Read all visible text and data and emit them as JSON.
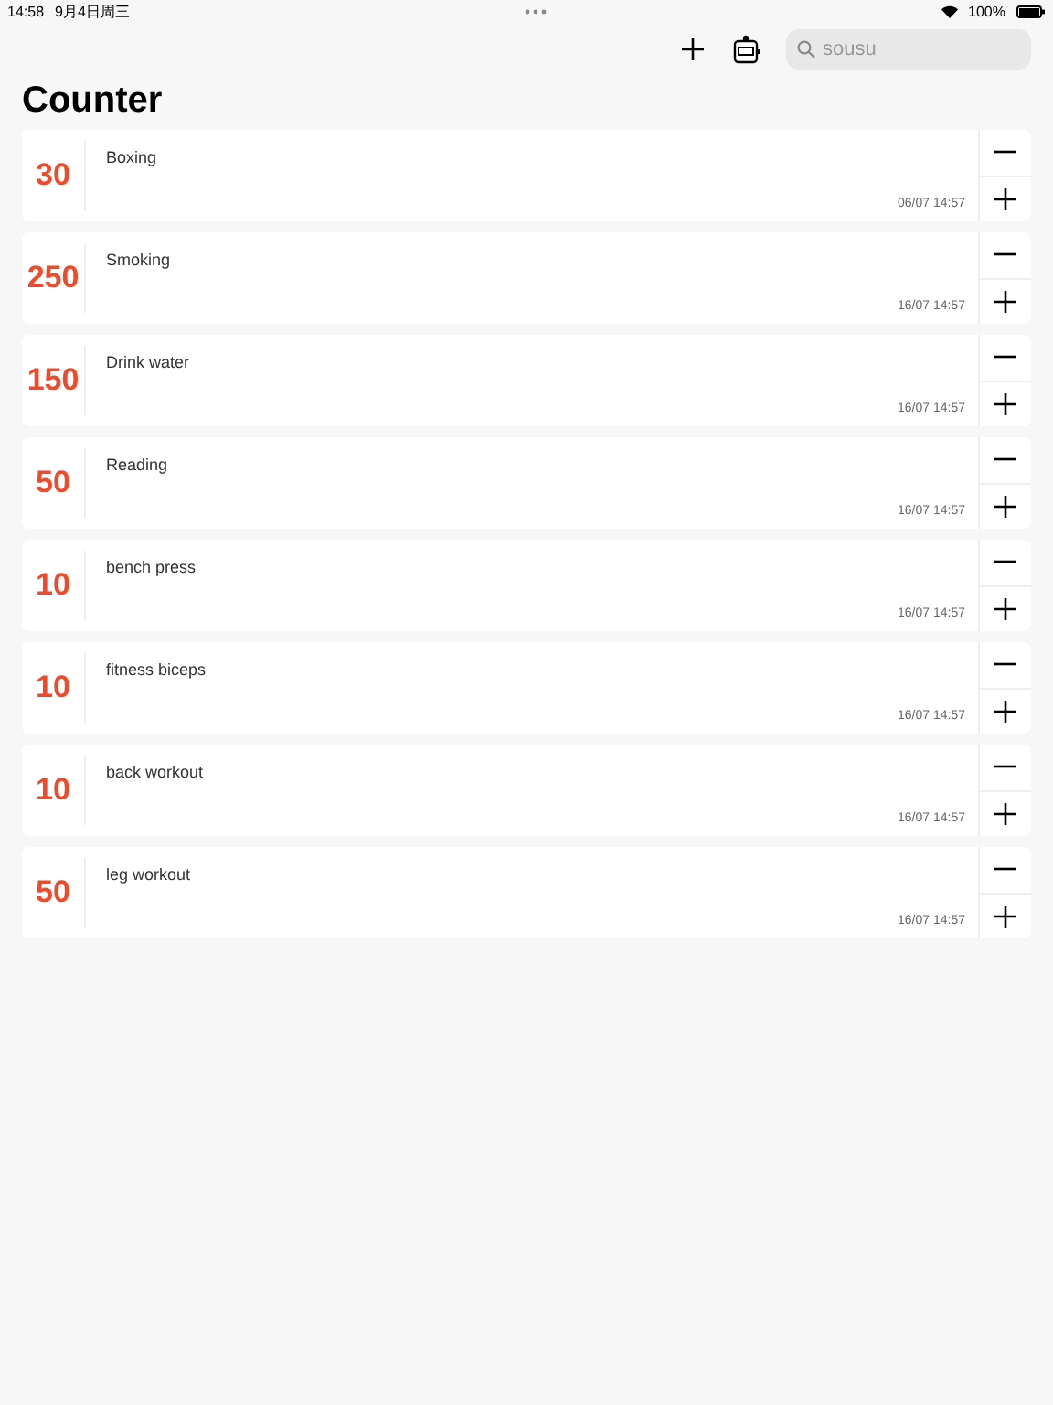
{
  "status_bar": {
    "time": "14:58",
    "date": "9月4日周三",
    "battery": "100%"
  },
  "toolbar": {
    "search": {
      "placeholder": "sousu"
    }
  },
  "title": "Counter",
  "counters": [
    {
      "count": "30",
      "name": "Boxing",
      "timestamp": "06/07 14:57"
    },
    {
      "count": "250",
      "name": "Smoking",
      "timestamp": "16/07 14:57"
    },
    {
      "count": "150",
      "name": "Drink water",
      "timestamp": "16/07 14:57"
    },
    {
      "count": "50",
      "name": "Reading",
      "timestamp": "16/07 14:57"
    },
    {
      "count": "10",
      "name": "bench press",
      "timestamp": "16/07 14:57"
    },
    {
      "count": "10",
      "name": "fitness biceps",
      "timestamp": "16/07 14:57"
    },
    {
      "count": "10",
      "name": "back workout",
      "timestamp": "16/07 14:57"
    },
    {
      "count": "50",
      "name": "leg workout",
      "timestamp": "16/07 14:57"
    }
  ]
}
